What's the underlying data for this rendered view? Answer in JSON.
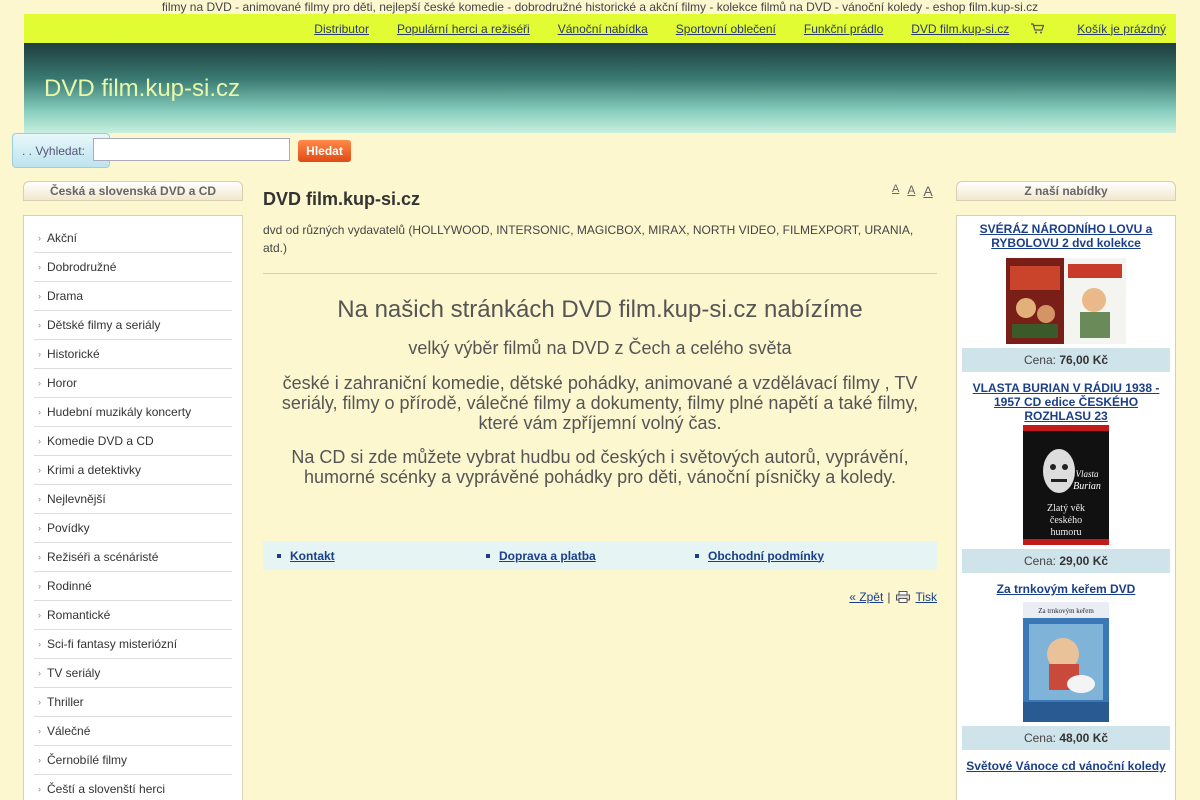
{
  "tagline": "filmy na DVD - animované filmy pro děti, nejlepší české komedie - dobrodružné historické a akční filmy - kolekce filmů na DVD - vánoční koledy - eshop film.kup-si.cz",
  "topnav": {
    "links": [
      "Distributor",
      "Populární herci a režiséři",
      "Vánoční nabídka",
      "Sportovní oblečení",
      "Funkční prádlo",
      "DVD film.kup-si.cz"
    ],
    "cart_label": "Košík je prázdný"
  },
  "banner": {
    "site_title": "DVD film.kup-si.cz"
  },
  "search": {
    "label": ". . Vyhledat:",
    "placeholder": "",
    "button": "Hledat"
  },
  "left": {
    "heading": "Česká a slovenská DVD a CD",
    "items": [
      "Akční",
      "Dobrodružné",
      "Drama",
      "Dětské filmy a seriály",
      "Historické",
      "Horor",
      "Hudební muzikály koncerty",
      "Komedie DVD a CD",
      "Krimi a detektivky",
      "Nejlevnější",
      "Povídky",
      "Režiséři a scénáristé",
      "Rodinné",
      "Romantické",
      "Sci-fi fantasy misteriózní",
      "TV seriály",
      "Thriller",
      "Válečné",
      "Černobílé filmy",
      "Čeští a slovenští herci"
    ]
  },
  "main": {
    "title": "DVD film.kup-si.cz",
    "font_sizes": [
      "A",
      "A",
      "A"
    ],
    "subtitle": "dvd od různých vydavatelů (HOLLYWOOD, INTERSONIC, MAGICBOX, MIRAX, NORTH VIDEO, FILMEXPORT, URANIA, atd.)",
    "headline": "Na našich stránkách DVD film.kup-si.cz nabízíme",
    "line1": "velký výběr filmů na DVD z Čech a celého světa",
    "para1": "české i zahraniční komedie, dětské pohádky, animované a vzdělávací filmy , TV seriály, filmy o přírodě, válečné filmy a dokumenty, filmy plné napětí a také filmy, které vám zpříjemní volný čas.",
    "para2": "Na CD si zde můžete vybrat hudbu od českých i světových autorů, vyprávění, humorné scénky a vyprávěné pohádky pro děti, vánoční písničky a koledy.",
    "links": [
      "Kontakt",
      "Doprava a platba",
      "Obchodní podmínky"
    ],
    "back": "« Zpět",
    "separator": "|",
    "print": "Tisk"
  },
  "right": {
    "heading": "Z naší nabídky",
    "price_label": "Cena:",
    "products": [
      {
        "name": "SVÉRÁZ NÁRODNÍHO LOVU a RYBOLOVU 2 dvd kolekce",
        "price": "76,00 Kč"
      },
      {
        "name": "VLASTA BURIAN V RÁDIU 1938 - 1957 CD edice ČESKÉHO ROZHLASU 23",
        "price": "29,00 Kč",
        "cover_text": [
          "Vlasta",
          "Burian",
          "Zlatý věk",
          "českého",
          "humoru"
        ]
      },
      {
        "name": "Za trnkovým keřem DVD",
        "price": "48,00 Kč",
        "cover_text": [
          "Za trnkovým keřem"
        ]
      },
      {
        "name": "Světové Vánoce cd vánoční koledy",
        "price": ""
      }
    ]
  },
  "colors": {
    "nav_bg": "#e1fc32",
    "page_bg": "#fdf7cf",
    "link": "#1a3f8a",
    "button": "#e14a14"
  }
}
